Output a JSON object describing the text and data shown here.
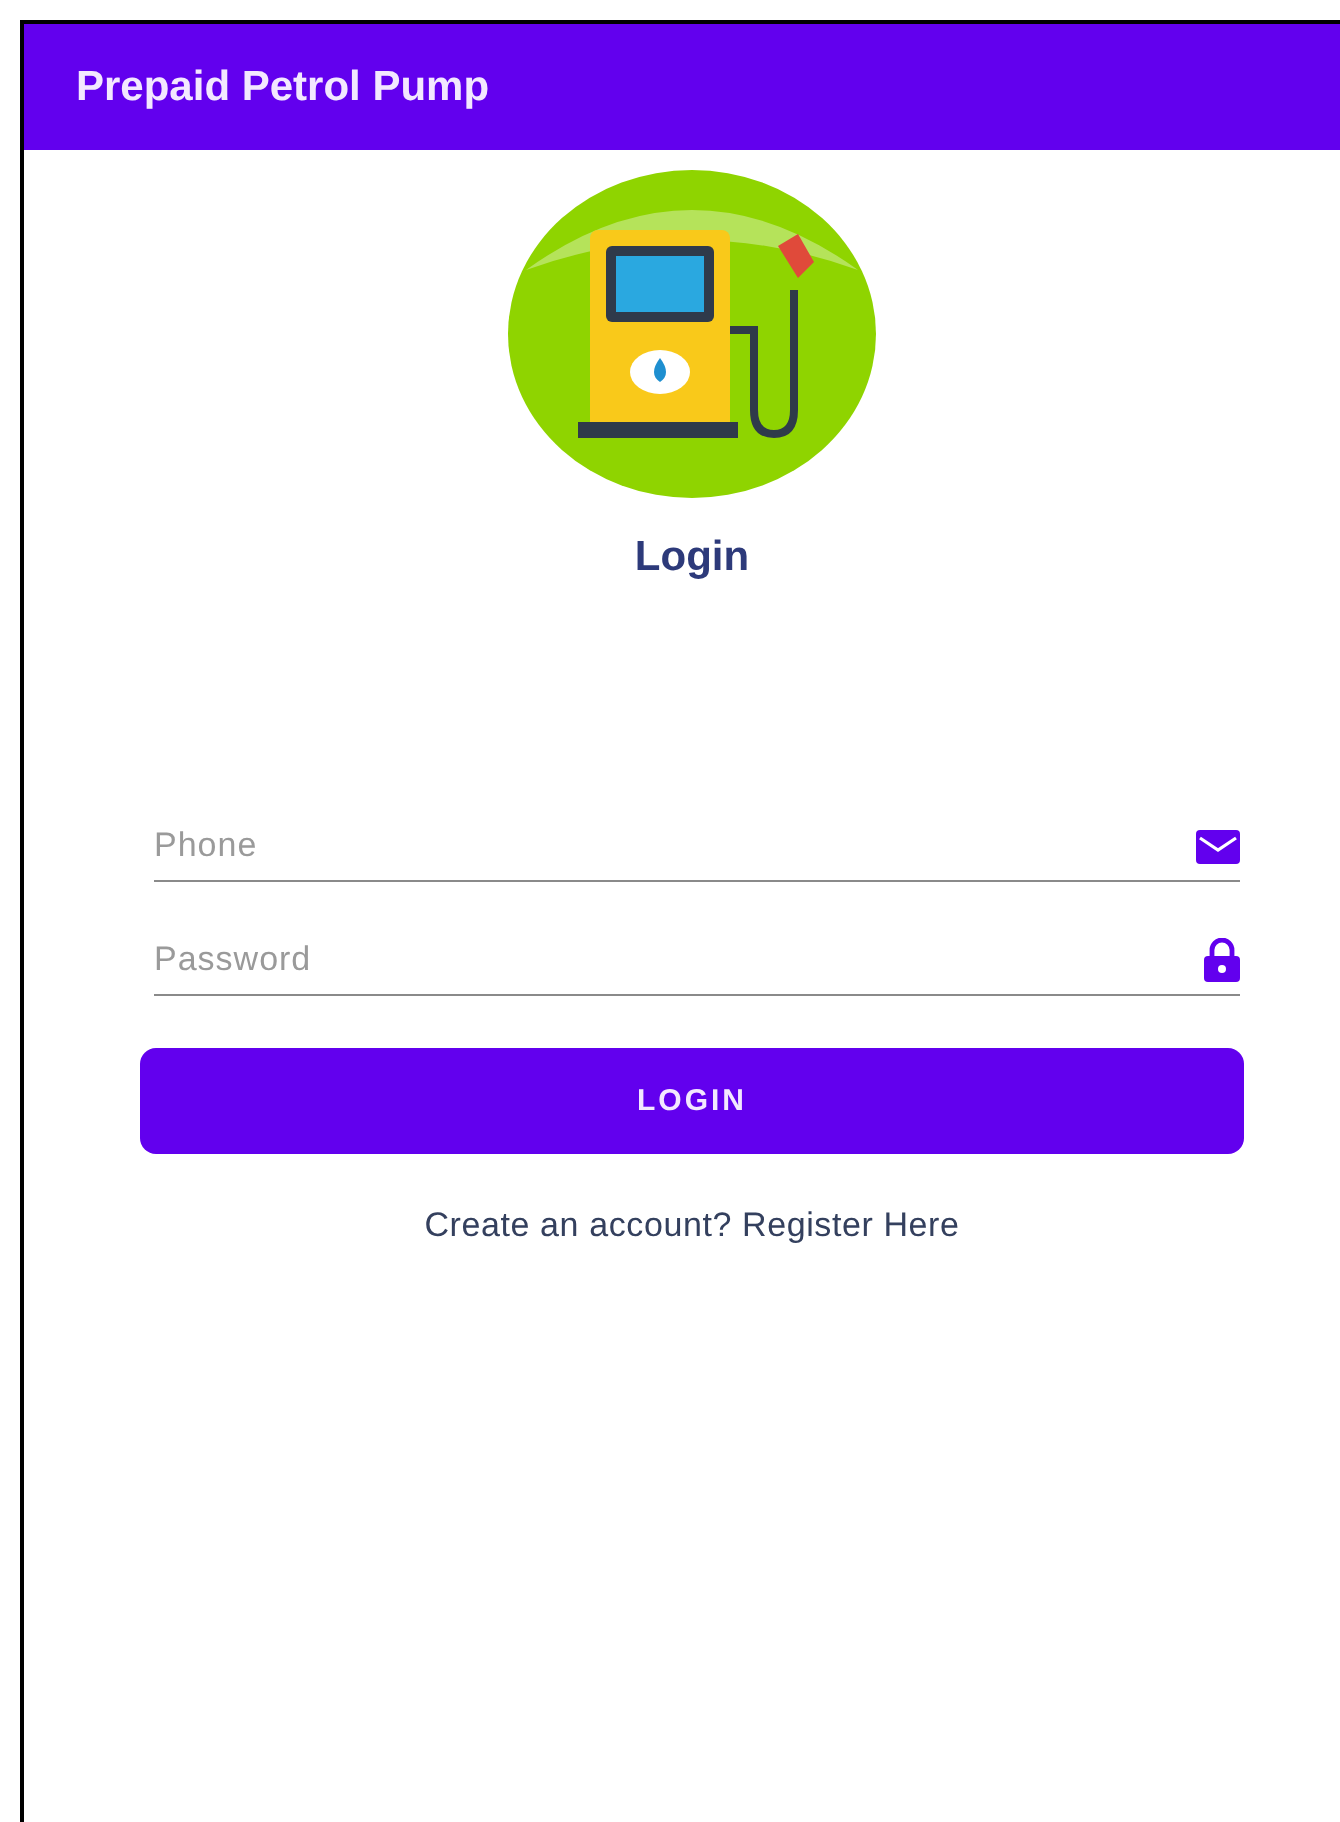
{
  "app_bar": {
    "title": "Prepaid Petrol Pump"
  },
  "heading": "Login",
  "fields": [
    {
      "placeholder": "Phone",
      "kind": "mail"
    },
    {
      "placeholder": "Password",
      "kind": "lock"
    }
  ],
  "login_button": "LOGIN",
  "register_link": "Create an account? Register Here"
}
